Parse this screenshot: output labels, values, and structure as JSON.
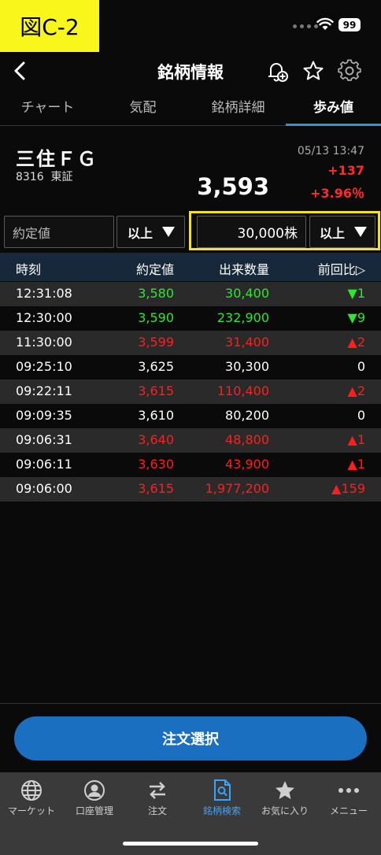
{
  "figure_label": "図C-2",
  "status": {
    "battery": "99"
  },
  "nav": {
    "title": "銘柄情報"
  },
  "tabs": [
    {
      "label": "チャート"
    },
    {
      "label": "気配"
    },
    {
      "label": "銘柄詳細"
    },
    {
      "label": "歩み値"
    }
  ],
  "stock": {
    "name": "三住ＦＧ",
    "code": "8316",
    "market": "東証",
    "price": "3,593",
    "time": "05/13 13:47",
    "change": "+137",
    "change_pct": "+3.96％"
  },
  "filters": {
    "price_placeholder": "約定値",
    "price_condition": "以上",
    "volume_value": "30,000株",
    "volume_condition": "以上"
  },
  "table": {
    "headers": {
      "time": "時刻",
      "price": "約定値",
      "volume": "出来数量",
      "diff": "前回比▷"
    },
    "rows": [
      {
        "time": "12:31:08",
        "price": "3,580",
        "volume": "30,400",
        "diff": "▼1",
        "color": "green"
      },
      {
        "time": "12:30:00",
        "price": "3,590",
        "volume": "232,900",
        "diff": "▼9",
        "color": "green"
      },
      {
        "time": "11:30:00",
        "price": "3,599",
        "volume": "31,400",
        "diff": "▲2",
        "color": "red"
      },
      {
        "time": "09:25:10",
        "price": "3,625",
        "volume": "30,300",
        "diff": "0",
        "color": "white"
      },
      {
        "time": "09:22:11",
        "price": "3,615",
        "volume": "110,400",
        "diff": "▲2",
        "color": "red"
      },
      {
        "time": "09:09:35",
        "price": "3,610",
        "volume": "80,200",
        "diff": "0",
        "color": "white"
      },
      {
        "time": "09:06:31",
        "price": "3,640",
        "volume": "48,800",
        "diff": "▲1",
        "color": "red"
      },
      {
        "time": "09:06:11",
        "price": "3,630",
        "volume": "43,900",
        "diff": "▲1",
        "color": "red"
      },
      {
        "time": "09:06:00",
        "price": "3,615",
        "volume": "1,977,200",
        "diff": "▲159",
        "color": "red"
      }
    ]
  },
  "order_button": "注文選択",
  "tabbar": [
    {
      "label": "マーケット",
      "icon": "globe-icon"
    },
    {
      "label": "口座管理",
      "icon": "person-icon"
    },
    {
      "label": "注文",
      "icon": "swap-arrows-icon"
    },
    {
      "label": "銘柄検索",
      "icon": "document-search-icon"
    },
    {
      "label": "お気に入り",
      "icon": "star-icon"
    },
    {
      "label": "メニュー",
      "icon": "more-dots-icon"
    }
  ],
  "colors": {
    "accent": "#1a6fc0",
    "up": "#ff1e1e",
    "down": "#2ee630",
    "highlight": "#f5e21a"
  }
}
